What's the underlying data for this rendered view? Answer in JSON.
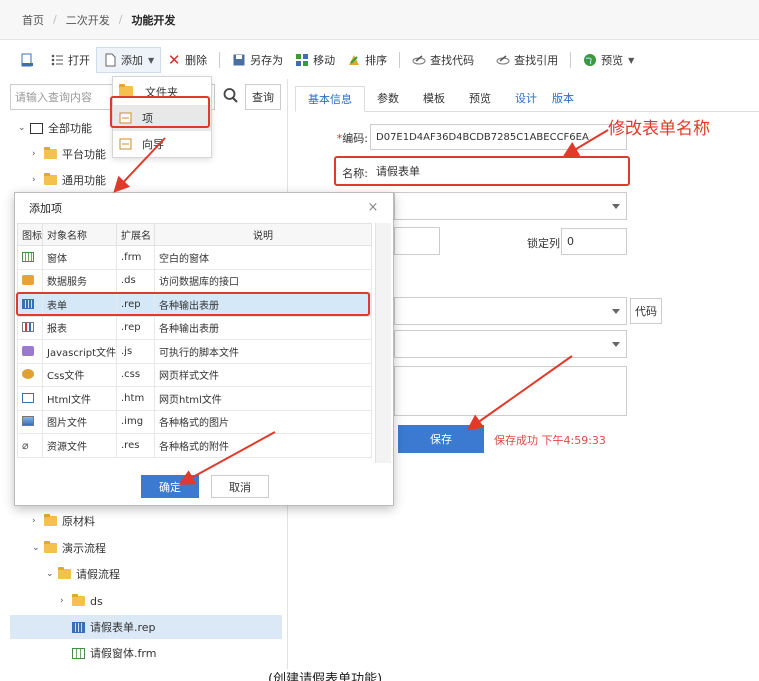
{
  "breadcrumb": {
    "home": "首页",
    "level2": "二次开发",
    "current": "功能开发"
  },
  "toolbar": {
    "open": "打开",
    "add": "添加",
    "delete": "删除",
    "save_as": "另存为",
    "move": "移动",
    "sort": "排序",
    "find_code": "查找代码",
    "find_ref": "查找引用",
    "preview": "预览"
  },
  "add_menu": {
    "folder": "文件夹",
    "item": "项",
    "wizard": "向导"
  },
  "search": {
    "placeholder": "请输入查询内容",
    "button": "查询"
  },
  "tree": {
    "root": "全部功能",
    "platform": "平台功能",
    "general": "通用功能",
    "raw_material": "原材料",
    "demo_flow": "演示流程",
    "leave_flow": "请假流程",
    "ds": "ds",
    "leave_form_rep": "请假表单.rep",
    "leave_form_frm": "请假窗体.frm"
  },
  "tabs": [
    "基本信息",
    "参数",
    "模板",
    "预览",
    "设计",
    "版本"
  ],
  "form": {
    "code_label": "编码:",
    "code_value": "D07E1D4AF36D4BCDB7285C1ABECCF6EA",
    "name_label": "名称:",
    "name_value": "请假表单",
    "lock_label": "锁定列",
    "lock_value": "0",
    "code_button": "代码",
    "save_button": "保存",
    "save_status": "保存成功 下午4:59:33"
  },
  "annotation": "修改表单名称",
  "dialog": {
    "title": "添加项",
    "close": "×",
    "headers": [
      "图标",
      "对象名称",
      "扩展名",
      "说明"
    ],
    "rows": [
      {
        "name": "窗体",
        "ext": ".frm",
        "desc": "空白的窗体"
      },
      {
        "name": "数据服务",
        "ext": ".ds",
        "desc": "访问数据库的接口"
      },
      {
        "name": "表单",
        "ext": ".rep",
        "desc": "各种输出表册"
      },
      {
        "name": "报表",
        "ext": ".rep",
        "desc": "各种输出表册"
      },
      {
        "name": "Javascript文件",
        "ext": ".js",
        "desc": "可执行的脚本文件"
      },
      {
        "name": "Css文件",
        "ext": ".css",
        "desc": "网页样式文件"
      },
      {
        "name": "Html文件",
        "ext": ".htm",
        "desc": "网页html文件"
      },
      {
        "name": "图片文件",
        "ext": ".img",
        "desc": "各种格式的图片"
      },
      {
        "name": "资源文件",
        "ext": ".res",
        "desc": "各种格式的附件"
      }
    ],
    "ok": "确定",
    "cancel": "取消"
  },
  "caption": "(创建请假表单功能)",
  "colors": {
    "accent": "#3b7ad0",
    "annotation_red": "#e03a2a",
    "selected_row": "#d5e8f7"
  }
}
